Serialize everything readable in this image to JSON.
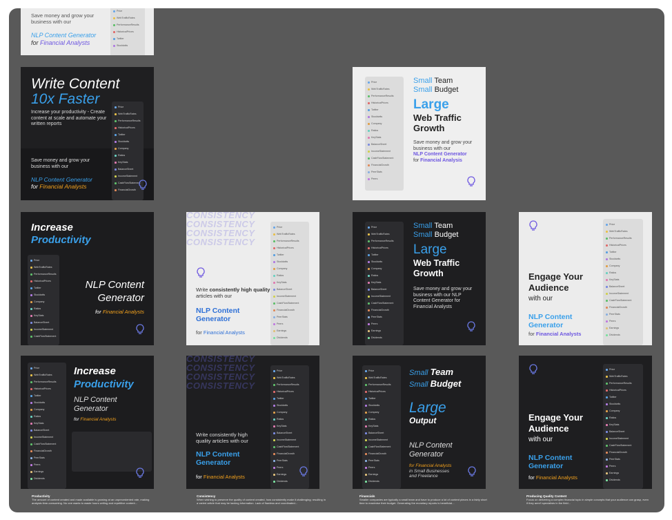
{
  "panel_items": [
    "Price",
    "WebTrafficRates",
    "PerformanceResults",
    "HistoricalPrices",
    "Twitter",
    "Stocktwits",
    "Company",
    "Ratios",
    "KeyStats",
    "BalanceSheet",
    "IncomeStatement",
    "CashFlowStatement",
    "FinancialGrowth",
    "PeerStats",
    "Peers",
    "Earnings",
    "Dividends"
  ],
  "panel_colors": [
    "#6aa7e8",
    "#e8c04a",
    "#5fbf6b",
    "#e06b6b",
    "#5aa0e0",
    "#b07be0",
    "#e0a04a",
    "#6ad0c0",
    "#e07bb0",
    "#7b8be0",
    "#d0d050",
    "#5fbf6b",
    "#e08a5a",
    "#8ab0e0",
    "#c07be0",
    "#e0c07b",
    "#7be0a0"
  ],
  "tiles": {
    "t1": {
      "line1": "Save money and grow your",
      "line2": "business with our",
      "nlp": "NLP Content Generator",
      "for": "for",
      "fa": "Financial Analysts"
    },
    "t2": {
      "title1": "Write Content",
      "title2": "10x Faster",
      "body": "Increase your productivity - Create content at scale and automate your written reports",
      "save": "Save money and grow your business with our",
      "nlp": "NLP Content Generator",
      "for": "for",
      "fa": "Financial Analysts"
    },
    "t3": {
      "a": "Small",
      "b": "Team",
      "c": "Small",
      "d": "Budget",
      "large": "Large",
      "wtg1": "Web Traffic",
      "wtg2": "Growth",
      "save": "Save money and grow your business with our",
      "nlp": "NLP Content Generator",
      "for": "for",
      "fa": "Financial Analysis"
    },
    "t4": {
      "title1": "Increase",
      "title2": "Productivity",
      "nlp1": "NLP Content",
      "nlp2": "Generator",
      "for": "for",
      "fa": "Financial Analysts"
    },
    "t5": {
      "cons": "CONSISTENCY",
      "w1": "Write",
      "w2": "consistently high",
      "w3": "quality",
      "w4": "articles with our",
      "nlp1": "NLP Content",
      "nlp2": "Generator",
      "for": "for",
      "fa": "Financial Analysts"
    },
    "t6": {
      "a": "Small",
      "b": "Team",
      "c": "Small",
      "d": "Budget",
      "large": "Large",
      "wtg1": "Web Traffic",
      "wtg2": "Growth",
      "save": "Save money and grow your business with our NLP Content Generator for Financial Analysts"
    },
    "t7": {
      "e1": "Engage Your",
      "e2": "Audience",
      "with": "with our",
      "nlp1": "NLP Content",
      "nlp2": "Generator",
      "for": "for",
      "fa": "Financial Analysts"
    },
    "t8": {
      "title1": "Increase",
      "title2": "Productivity",
      "nlp1": "NLP Content",
      "nlp2": "Generator",
      "for": "for",
      "fa": "Financial Analysts"
    },
    "t9": {
      "cons": "CONSISTENCY",
      "w1": "Write consistently high",
      "w2": "quality articles with our",
      "nlp1": "NLP Content",
      "nlp2": "Generator",
      "for": "for",
      "fa": "Financial Analysts"
    },
    "t10": {
      "a": "Small",
      "b": "Team",
      "c": "Small",
      "d": "Budget",
      "large": "Large",
      "output": "Output",
      "nlp1": "NLP Content",
      "nlp2": "Generator",
      "for": "for Financial Analysts",
      "in": "in Small Businesses",
      "and": "and Freelance"
    },
    "t11": {
      "e1": "Engage Your",
      "e2": "Audience",
      "with": "with our",
      "nlp1": "NLP Content",
      "nlp2": "Generator",
      "for": "for",
      "fa": "Financial Analysts"
    }
  },
  "captions": [
    {
      "title": "Productivity",
      "text": "The amount of content created and made available is growing at an unprecedented rate, making analysis time-consuming. No one wants to waste hours writing and repetitive content..."
    },
    {
      "title": "Consistency",
      "text": "When wishing to preserve the quality of content created, how consistently make it challenging; resulting in a varied article that may be lacking information. Lack of flawless and coordinated..."
    },
    {
      "title": "Financials",
      "text": "Smaller companies are typically a small team and have to produce a lot of content pieces in a fairly short time to maximise their budget. Generating the monetary reports is beneficial..."
    },
    {
      "title": "Producing Quality Content",
      "text": "Focus on delivering a complex financial topic in simple concepts that your audience can grasp, even if they aren't specialists in the field..."
    }
  ]
}
